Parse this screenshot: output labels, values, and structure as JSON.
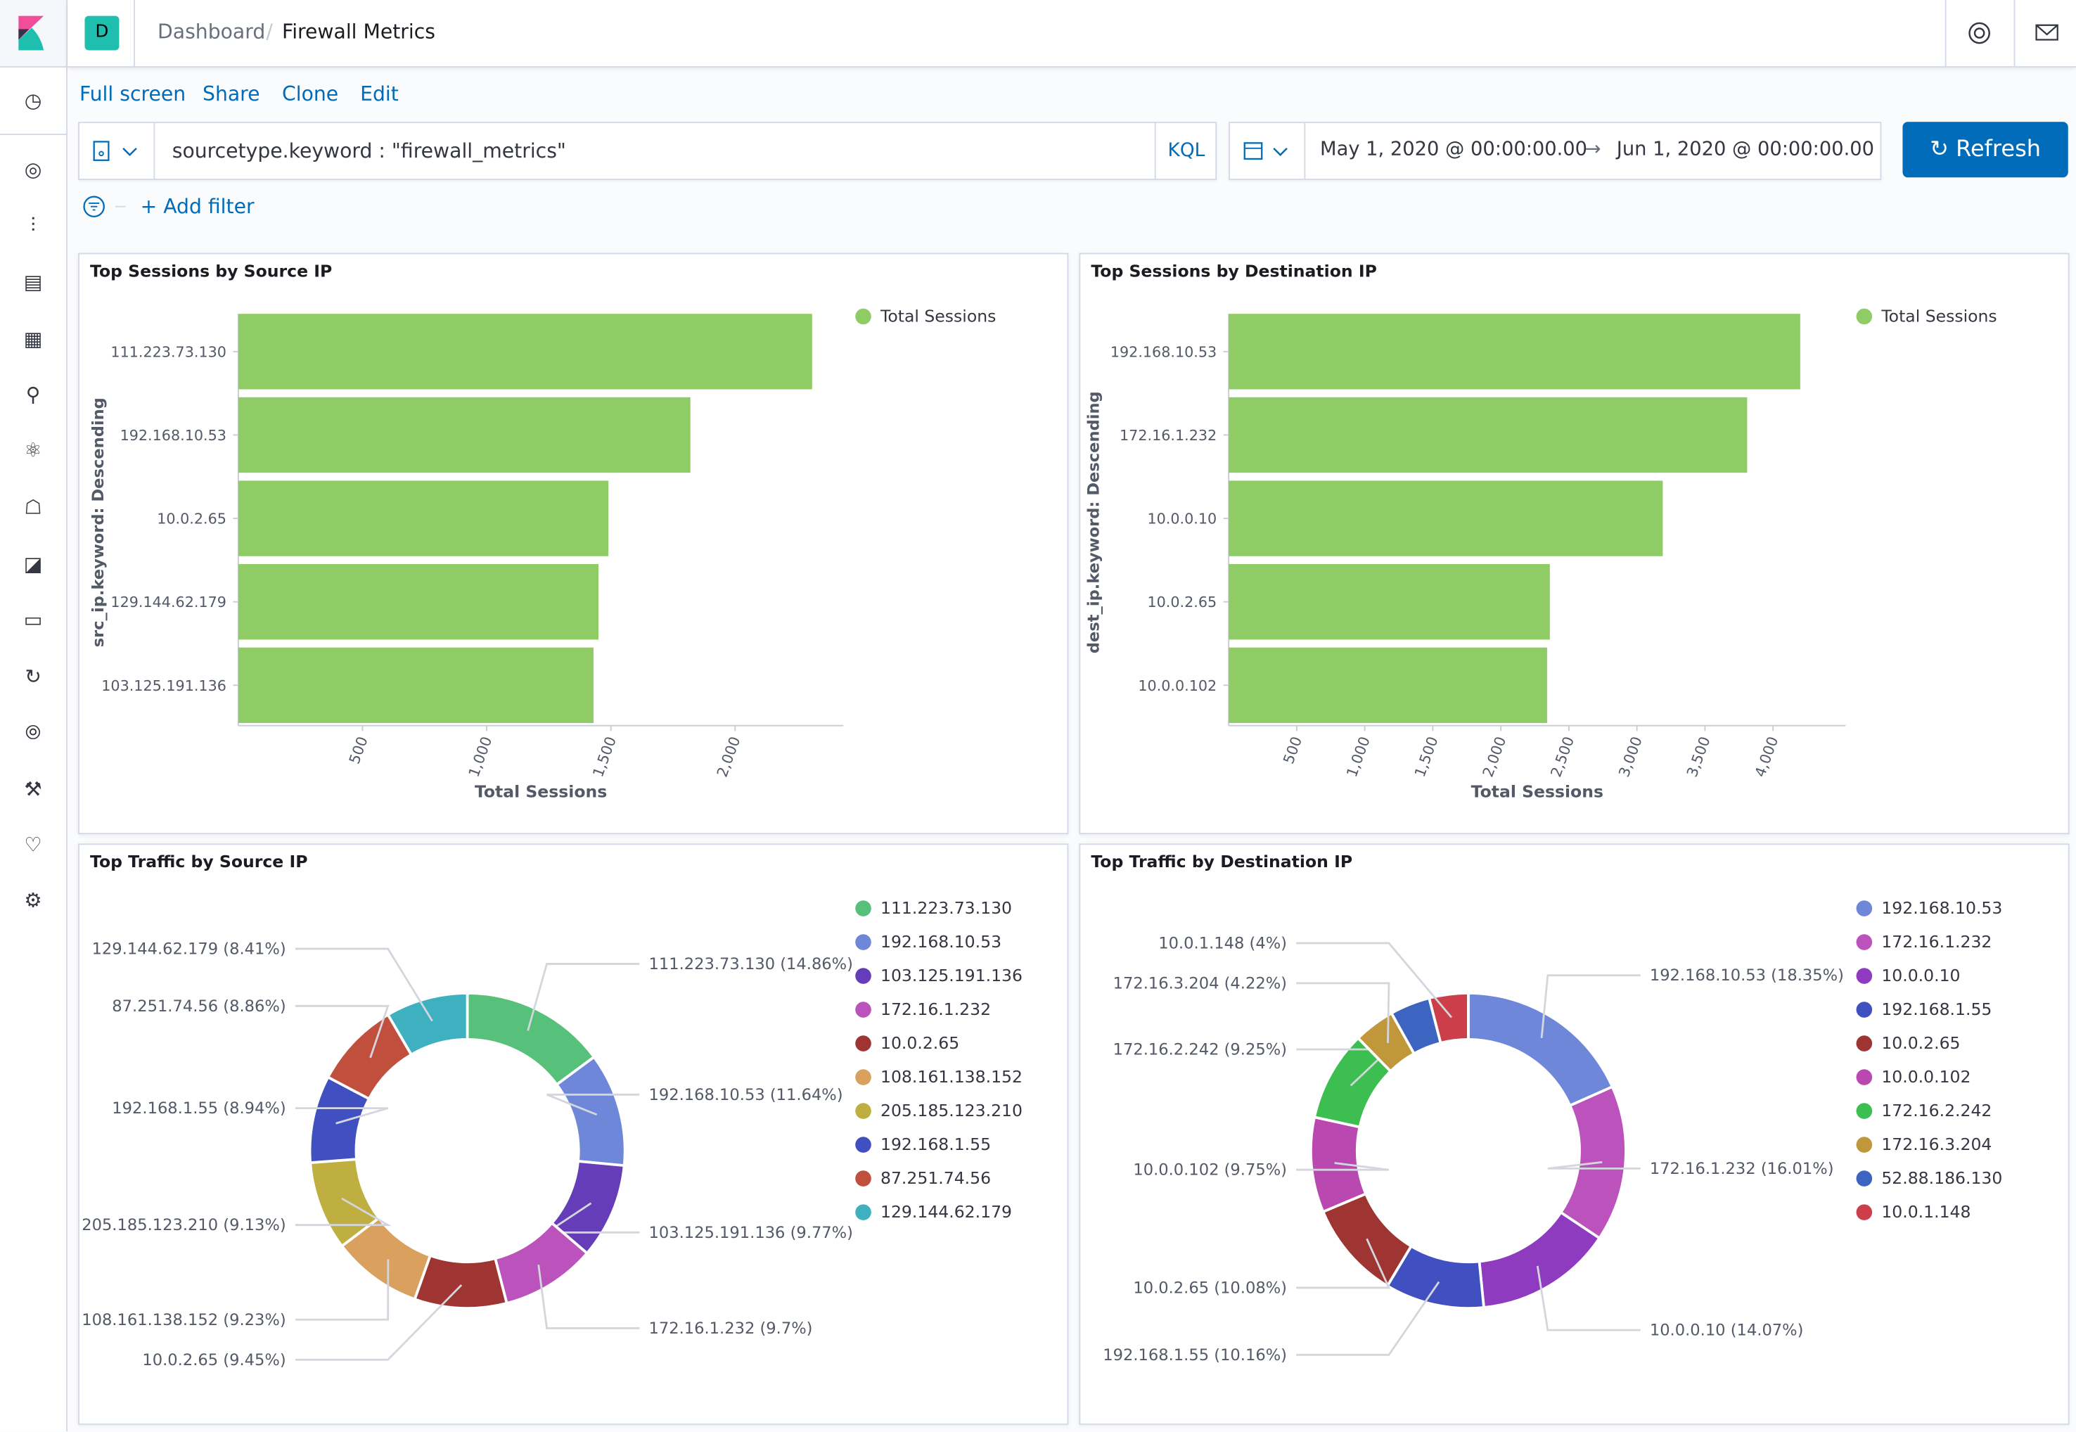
{
  "header": {
    "space_initial": "D",
    "breadcrumb": [
      "Dashboard",
      "Firewall Metrics"
    ],
    "help_icon": "help-icon",
    "mail_icon": "mail-icon"
  },
  "sidebar": {
    "icons": [
      "clock-icon",
      "compass-icon",
      "visualize-icon",
      "dashboard-icon",
      "canvas-icon",
      "maps-icon",
      "ml-icon",
      "siem-icon",
      "apm-icon",
      "infra-icon",
      "uptime-icon",
      "logs-icon",
      "devtools-icon",
      "monitoring-icon",
      "gear-icon"
    ]
  },
  "top_menu": [
    "Full screen",
    "Share",
    "Clone",
    "Edit"
  ],
  "query": {
    "value": "sourcetype.keyword : \"firewall_metrics\"",
    "language": "KQL"
  },
  "time": {
    "start": "May 1, 2020 @ 00:00:00.00",
    "end": "Jun 1, 2020 @ 00:00:00.00",
    "arrow": "→"
  },
  "refresh_label": "Refresh",
  "add_filter": "+ Add filter",
  "colors": {
    "accent": "#006bb8",
    "bar": "#8fcc66"
  },
  "chart_data": [
    {
      "type": "bar",
      "orientation": "horizontal",
      "title": "Top Sessions by Source IP",
      "ylabel": "src_ip.keyword: Descending",
      "xlabel": "Total Sessions",
      "legend": "Total Sessions",
      "legend_position": "top-right",
      "categories": [
        "111.223.73.130",
        "192.168.10.53",
        "10.0.2.65",
        "129.144.62.179",
        "103.125.191.136"
      ],
      "values": [
        2310,
        1820,
        1490,
        1450,
        1430
      ],
      "ticks": [
        "500",
        "1,000",
        "1,500",
        "2,000"
      ],
      "tick_values": [
        500,
        1000,
        1500,
        2000
      ],
      "xlim": [
        0,
        2436
      ]
    },
    {
      "type": "bar",
      "orientation": "horizontal",
      "title": "Top Sessions by Destination IP",
      "ylabel": "dest_ip.keyword: Descending",
      "xlabel": "Total Sessions",
      "legend": "Total Sessions",
      "legend_position": "top-right",
      "categories": [
        "192.168.10.53",
        "172.16.1.232",
        "10.0.0.10",
        "10.0.2.65",
        "10.0.0.102"
      ],
      "values": [
        4200,
        3810,
        3190,
        2360,
        2340
      ],
      "ticks": [
        "500",
        "1,000",
        "1,500",
        "2,000",
        "2,500",
        "3,000",
        "3,500",
        "4,000"
      ],
      "tick_values": [
        500,
        1000,
        1500,
        2000,
        2500,
        3000,
        3500,
        4000
      ],
      "xlim": [
        0,
        4534
      ]
    },
    {
      "type": "pie",
      "donut": true,
      "title": "Top Traffic by Source IP",
      "legend_position": "right",
      "labels": [
        "111.223.73.130",
        "192.168.10.53",
        "103.125.191.136",
        "172.16.1.232",
        "10.0.2.65",
        "108.161.138.152",
        "205.185.123.210",
        "192.168.1.55",
        "87.251.74.56",
        "129.144.62.179"
      ],
      "values": [
        14.86,
        11.64,
        9.77,
        9.7,
        9.45,
        9.23,
        9.13,
        8.94,
        8.86,
        8.41
      ],
      "slice_labels": [
        "111.223.73.130 (14.86%)",
        "192.168.10.53 (11.64%)",
        "103.125.191.136 (9.77%)",
        "172.16.1.232 (9.7%)",
        "10.0.2.65 (9.45%)",
        "108.161.138.152 (9.23%)",
        "205.185.123.210 (9.13%)",
        "192.168.1.55 (8.94%)",
        "87.251.74.56 (8.86%)",
        "129.144.62.179 (8.41%)"
      ],
      "colors": [
        "#57c17b",
        "#6f87d8",
        "#663db8",
        "#bc52bc",
        "#9e3533",
        "#daa05d",
        "#bfaf40",
        "#4050c1",
        "#c14f3d",
        "#3fb0c0"
      ]
    },
    {
      "type": "pie",
      "donut": true,
      "title": "Top Traffic by Destination IP",
      "legend_position": "right",
      "labels": [
        "192.168.10.53",
        "172.16.1.232",
        "10.0.0.10",
        "192.168.1.55",
        "10.0.2.65",
        "10.0.0.102",
        "172.16.2.242",
        "172.16.3.204",
        "52.88.186.130",
        "10.0.1.148"
      ],
      "values": [
        18.35,
        16.01,
        14.07,
        10.16,
        10.08,
        9.75,
        9.25,
        4.22,
        4.11,
        4
      ],
      "slice_labels": [
        "192.168.10.53 (18.35%)",
        "172.16.1.232 (16.01%)",
        "10.0.0.10 (14.07%)",
        "192.168.1.55 (10.16%)",
        "10.0.2.65 (10.08%)",
        "10.0.0.102 (9.75%)",
        "172.16.2.242 (9.25%)",
        "172.16.3.204 (4.22%)",
        "",
        "10.0.1.148 (4%)"
      ],
      "colors": [
        "#6f87d8",
        "#bc52bc",
        "#8e3bbf",
        "#4050c1",
        "#9e3533",
        "#b949b0",
        "#3cbf50",
        "#c0983b",
        "#3d64c0",
        "#cc3e4a"
      ]
    }
  ]
}
